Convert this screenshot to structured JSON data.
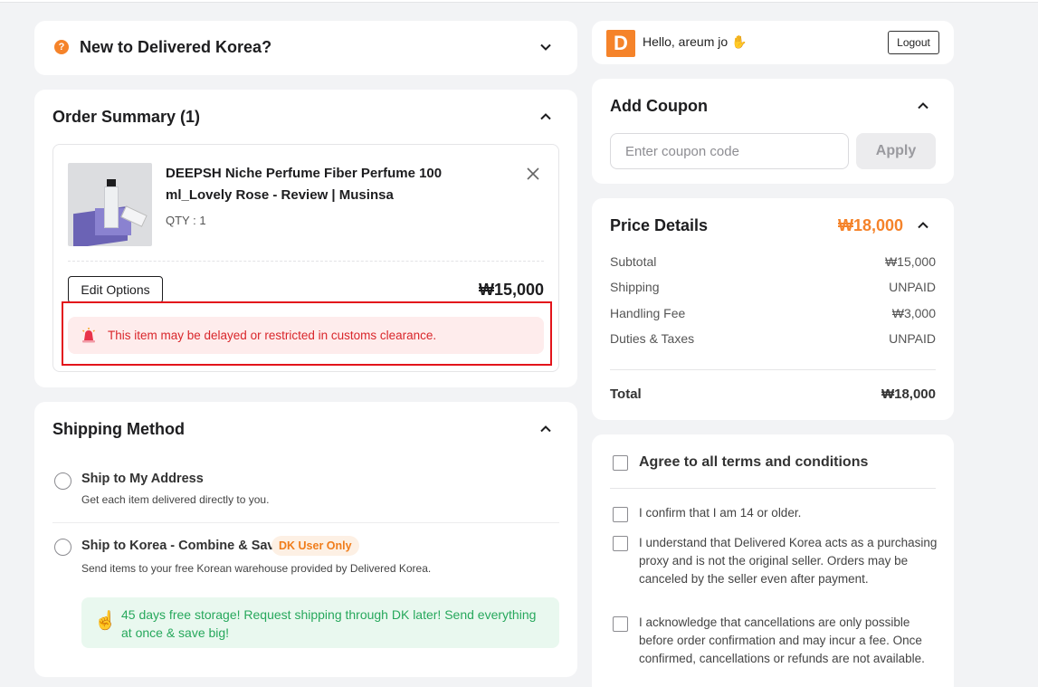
{
  "welcome": {
    "title": "New to Delivered Korea?",
    "icon": "question-icon"
  },
  "order": {
    "title": "Order Summary (1)",
    "item": {
      "name": "DEEPSH Niche Perfume Fiber Perfume 100 ml_Lovely Rose - Review | Musinsa",
      "qty": "QTY : 1",
      "price": "₩15,000",
      "edit_label": "Edit Options"
    },
    "warning": "This item may be delayed or restricted in customs clearance."
  },
  "shipping": {
    "title": "Shipping Method",
    "options": [
      {
        "label": "Ship to My Address",
        "desc": "Get each item delivered directly to you."
      },
      {
        "label": "Ship to Korea - Combine & Save",
        "badge": "DK User Only",
        "desc": "Send items to your free Korean warehouse provided by Delivered Korea."
      }
    ],
    "promo": "45 days free storage! Request shipping through DK later! Send everything at once & save big!"
  },
  "user": {
    "logo": "D",
    "greeting": "Hello, areum jo",
    "logout": "Logout"
  },
  "coupon": {
    "title": "Add Coupon",
    "placeholder": "Enter coupon code",
    "apply": "Apply"
  },
  "price": {
    "title": "Price Details",
    "total_header": "₩18,000",
    "rows": [
      {
        "label": "Subtotal",
        "value": "₩15,000"
      },
      {
        "label": "Shipping",
        "value": "UNPAID"
      },
      {
        "label": "Handling Fee",
        "value": "₩3,000"
      },
      {
        "label": "Duties & Taxes",
        "value": "UNPAID"
      }
    ],
    "total_label": "Total",
    "total_value": "₩18,000"
  },
  "terms": {
    "all": "Agree to all terms and conditions",
    "items": [
      "I confirm that I am 14 or older.",
      "I understand that Delivered Korea acts as a purchasing proxy and is not the original seller. Orders may be canceled by the seller even after payment.",
      "I acknowledge that cancellations are only possible before order confirmation and may incur a fee. Once confirmed, cancellations or refunds are not available."
    ]
  },
  "colors": {
    "accent": "#f5832a",
    "warning": "#d9262b",
    "success": "#27a85c"
  }
}
